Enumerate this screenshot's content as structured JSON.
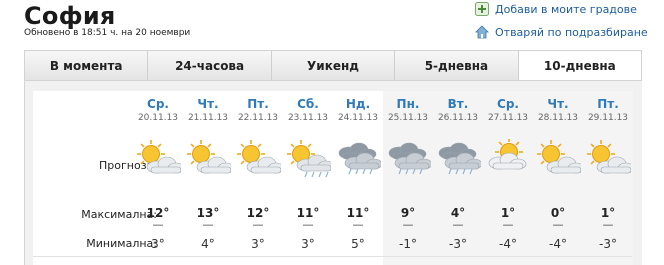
{
  "header": {
    "city": "София",
    "updated": "Обновено в 18:51 ч. на 20 ноември",
    "add_link": "Добави в моите градове",
    "default_link": "Отваряй по подразбиране"
  },
  "tabs": [
    {
      "label": "В момента",
      "active": false
    },
    {
      "label": "24-часова",
      "active": false
    },
    {
      "label": "Уикенд",
      "active": false
    },
    {
      "label": "5-дневна",
      "active": false
    },
    {
      "label": "10-дневна",
      "active": true
    }
  ],
  "labels": {
    "forecast": "Прогноза:",
    "max": "Максимална:",
    "min": "Минимална:"
  },
  "days": [
    {
      "name": "Ср.",
      "date": "20.11.13",
      "icon": "sun-cloud-icon",
      "max": "12°",
      "min": "3°"
    },
    {
      "name": "Чт.",
      "date": "21.11.13",
      "icon": "sun-cloud-icon",
      "max": "13°",
      "min": "4°"
    },
    {
      "name": "Пт.",
      "date": "22.11.13",
      "icon": "sun-cloud-icon",
      "max": "12°",
      "min": "3°"
    },
    {
      "name": "Сб.",
      "date": "23.11.13",
      "icon": "sun-cloud-rain-icon",
      "max": "11°",
      "min": "3°"
    },
    {
      "name": "Нд.",
      "date": "24.11.13",
      "icon": "cloud-rain-icon",
      "max": "11°",
      "min": "5°"
    },
    {
      "name": "Пн.",
      "date": "25.11.13",
      "icon": "cloud-rain-icon",
      "max": "9°",
      "min": "-1°"
    },
    {
      "name": "Вт.",
      "date": "26.11.13",
      "icon": "cloud-rain-icon",
      "max": "4°",
      "min": "-3°"
    },
    {
      "name": "Ср.",
      "date": "27.11.13",
      "icon": "sun-behind-cloud-icon",
      "max": "1°",
      "min": "-4°"
    },
    {
      "name": "Чт.",
      "date": "28.11.13",
      "icon": "sun-cloud-icon",
      "max": "0°",
      "min": "-4°"
    },
    {
      "name": "Пт.",
      "date": "29.11.13",
      "icon": "sun-cloud-icon",
      "max": "1°",
      "min": "-3°"
    }
  ],
  "colors": {
    "link": "#1d5c9c",
    "day_name": "#2f7ab8"
  }
}
